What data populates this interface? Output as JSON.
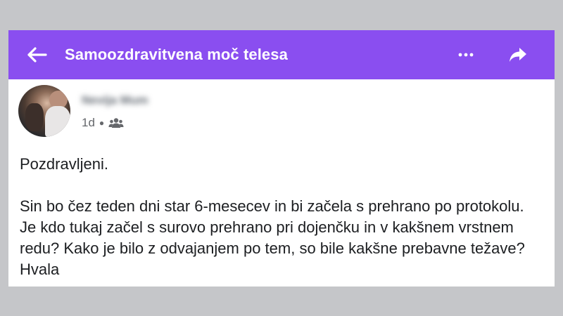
{
  "header": {
    "title": "Samoozdravitvena moč telesa",
    "back_icon": "arrow-left-icon",
    "more_icon": "more-dots-icon",
    "share_icon": "share-arrow-icon",
    "bar_color": "#8a4ef0"
  },
  "post": {
    "author_name": "Nevija Mum",
    "time": "1d",
    "audience_icon": "group-icon",
    "greeting": "Pozdravljeni.",
    "text": "Sin bo čez teden dni star 6-mesecev in bi začela s prehrano po protokolu. Je kdo tukaj začel s surovo prehrano pri dojenčku in v kakšnem vrstnem redu? Kako je bilo z odvajanjem po tem, so bile kakšne prebavne težave? Hvala"
  }
}
